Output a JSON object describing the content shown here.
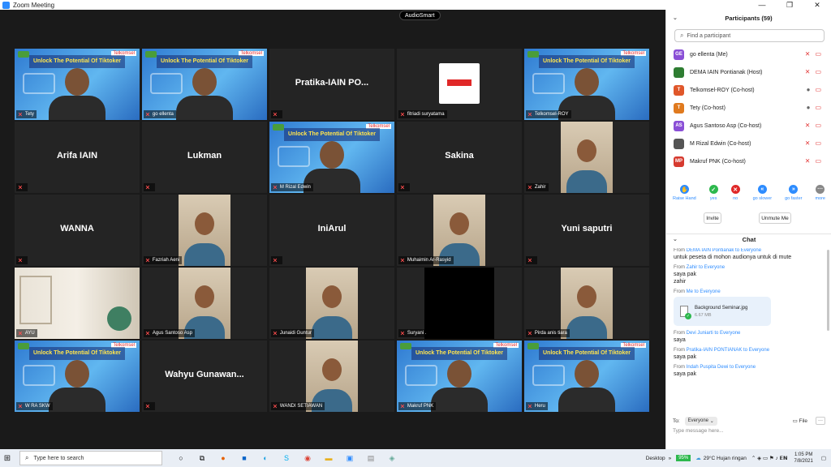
{
  "window": {
    "title": "Zoom Meeting",
    "controls": [
      "—",
      "❐",
      "✕"
    ]
  },
  "audio_badge": "AudioSmart",
  "slide": {
    "banner": "Unlock The Potential Of Tiktoker",
    "brand": "Telkomsel",
    "sub": "WEBINAR"
  },
  "tiles": [
    {
      "label": "Tety",
      "center": "",
      "type": "slide-person"
    },
    {
      "label": "go ellenta",
      "center": "",
      "type": "slide-person"
    },
    {
      "label": "",
      "center": "Pratika-IAIN PO...",
      "type": "name"
    },
    {
      "label": "fitriadi suryatama",
      "center": "",
      "type": "logo"
    },
    {
      "label": "Telkomsel-ROY",
      "center": "",
      "type": "slide-person"
    },
    {
      "label": "",
      "center": "Arifa IAIN",
      "type": "name"
    },
    {
      "label": "",
      "center": "Lukman",
      "type": "name"
    },
    {
      "label": "M Rizal Edwin",
      "center": "",
      "type": "slide-person"
    },
    {
      "label": "",
      "center": "Sakina",
      "type": "name"
    },
    {
      "label": "Zahir",
      "center": "",
      "type": "photo"
    },
    {
      "label": "",
      "center": "WANNA",
      "type": "name"
    },
    {
      "label": "Fazriah Aeni",
      "center": "",
      "type": "photo"
    },
    {
      "label": "",
      "center": "IniArul",
      "type": "name"
    },
    {
      "label": "Muhaimin Ar-Rasyid",
      "center": "",
      "type": "photo"
    },
    {
      "label": "",
      "center": "Yuni saputri",
      "type": "name"
    },
    {
      "label": "AYU",
      "center": "",
      "type": "room"
    },
    {
      "label": "Agus Santoso Asp",
      "center": "",
      "type": "photo"
    },
    {
      "label": "Junaidi Guntur",
      "center": "",
      "type": "photo"
    },
    {
      "label": "Suryani .",
      "center": "",
      "type": "dark"
    },
    {
      "label": "Pirda anis tiara",
      "center": "",
      "type": "photo"
    },
    {
      "label": "W RA SKW",
      "center": "",
      "type": "slide-person"
    },
    {
      "label": "",
      "center": "Wahyu Gunawan...",
      "type": "name"
    },
    {
      "label": "WANDI SETIAWAN",
      "center": "",
      "type": "photo"
    },
    {
      "label": "Makruf PNK",
      "center": "",
      "type": "slide-person"
    },
    {
      "label": "Heru",
      "center": "",
      "type": "slide-person"
    }
  ],
  "participants": {
    "title": "Participants (59)",
    "search_placeholder": "Find a participant",
    "list": [
      {
        "initials": "GE",
        "name": "go ellenta (Me)",
        "color": "#8a4fd6",
        "mic": "muted"
      },
      {
        "initials": "",
        "name": "DEMA IAIN Pontianak (Host)",
        "color": "#2e7d32",
        "mic": "muted"
      },
      {
        "initials": "T",
        "name": "Telkomsel-ROY (Co-host)",
        "color": "#e0572a",
        "mic": "on"
      },
      {
        "initials": "T",
        "name": "Tety (Co-host)",
        "color": "#e07a1e",
        "mic": "on"
      },
      {
        "initials": "AS",
        "name": "Agus Santoso Asp (Co-host)",
        "color": "#8a4fd6",
        "mic": "muted"
      },
      {
        "initials": "",
        "name": "M Rizal Edwin (Co-host)",
        "color": "#555555",
        "mic": "muted"
      },
      {
        "initials": "MP",
        "name": "Makruf PNK (Co-host)",
        "color": "#d63a2f",
        "mic": "muted"
      }
    ],
    "reactions": [
      {
        "label": "Raise Hand",
        "glyph": "✋",
        "color": "#2d8cff"
      },
      {
        "label": "yes",
        "glyph": "✓",
        "color": "#2db84d"
      },
      {
        "label": "no",
        "glyph": "✕",
        "color": "#e02828"
      },
      {
        "label": "go slower",
        "glyph": "«",
        "color": "#2d8cff"
      },
      {
        "label": "go faster",
        "glyph": "»",
        "color": "#2d8cff"
      },
      {
        "label": "more",
        "glyph": "···",
        "color": "#888888"
      }
    ],
    "invite_label": "Invite",
    "unmute_label": "Unmute Me"
  },
  "chat": {
    "title": "Chat",
    "messages": [
      {
        "from": "From",
        "sender": "DEMA IAIN Pontianak to Everyone",
        "lines": [
          "untuk peseta di mohon audionya untuk di mute"
        ]
      },
      {
        "from": "From",
        "sender": "Zahir to Everyone",
        "lines": [
          "saya pak",
          "zahir"
        ]
      },
      {
        "from": "From",
        "sender": "Me to Everyone",
        "lines": [],
        "file": {
          "name": "Background Seminar.jpg",
          "size": "6.67 MB"
        }
      },
      {
        "from": "From",
        "sender": "Devi Juniarti to Everyone",
        "lines": [
          "saya"
        ]
      },
      {
        "from": "From",
        "sender": "Pratika-IAIN PONTIANAK to Everyone",
        "lines": [
          "saya pak"
        ]
      },
      {
        "from": "From",
        "sender": "Indah Puspita Dewi to Everyone",
        "lines": [
          "saya pak"
        ]
      }
    ],
    "to_label": "To:",
    "to_value": "Everyone",
    "file_label": "File",
    "input_placeholder": "Type message here..."
  },
  "taskbar": {
    "search_placeholder": "Type here to search",
    "desktop_label": "Desktop",
    "battery": "95%",
    "weather": "29°C  Hujan ringan",
    "time": "1:05 PM",
    "date": "7/8/2021"
  }
}
